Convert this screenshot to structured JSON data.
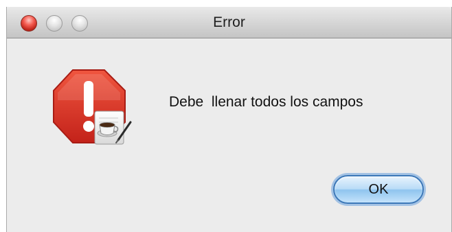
{
  "window": {
    "title": "Error"
  },
  "icons": {
    "alert": "stop-alert-icon",
    "app_badge": "coffee-cup-icon"
  },
  "dialog": {
    "message": "Debe  llenar todos los campos",
    "ok_label": "OK"
  },
  "colors": {
    "stop_red": "#d9312a",
    "button_blue": "#8fc4ee",
    "background": "#ececec"
  }
}
